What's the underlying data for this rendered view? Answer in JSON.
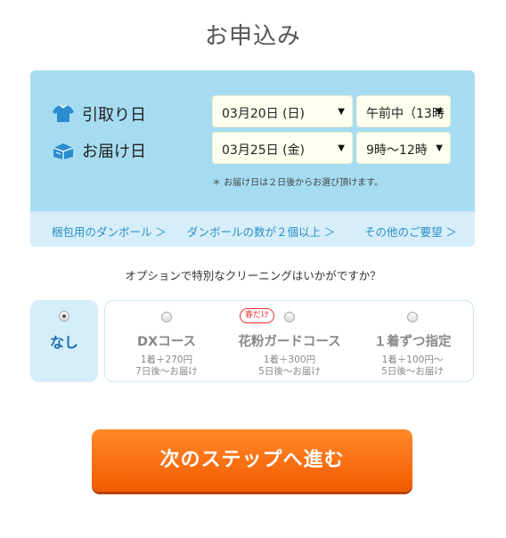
{
  "page": {
    "title": "お申込み"
  },
  "schedule": {
    "pickup": {
      "label": "引取り日",
      "date": "03月20日 (日)",
      "time": "午前中（13時"
    },
    "delivery": {
      "label": "お届け日",
      "date": "03月25日 (金)",
      "time": "9時〜12時"
    },
    "note": "＊ お届け日は２日後からお選び頂けます。"
  },
  "links": [
    {
      "label": "梱包用のダンボール ＞"
    },
    {
      "label": "ダンボールの数が２個以上 ＞"
    },
    {
      "label": "その他のご要望 ＞"
    }
  ],
  "options": {
    "question": "オプションで特別なクリーニングはいかがですか？",
    "selected": "none",
    "none": {
      "label": "なし"
    },
    "items": [
      {
        "name": "DXコース",
        "price": "1着＋270円",
        "delivery": "7日後〜お届け"
      },
      {
        "name": "花粉ガードコース",
        "badge": "春だけ",
        "price": "1着＋300円",
        "delivery": "5日後〜お届け"
      },
      {
        "name": "１着ずつ指定",
        "price": "1着＋100円〜",
        "delivery": "5日後〜お届け"
      }
    ]
  },
  "next_button": {
    "label": "次のステップへ進む"
  },
  "colors": {
    "accent_blue": "#a6dcf2",
    "link_blue": "#2a8fc9",
    "button_orange": "#f25a00"
  }
}
